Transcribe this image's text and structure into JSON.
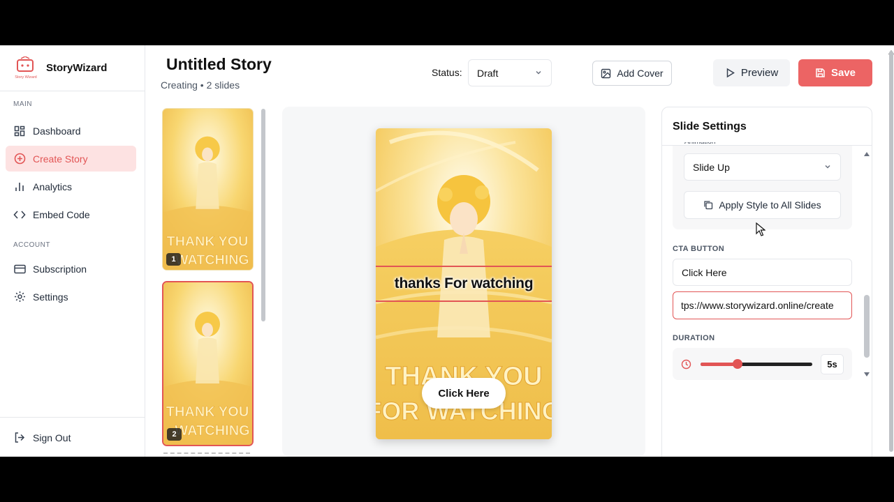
{
  "app": {
    "name": "StoryWizard",
    "logo_caption": "Story Wizard"
  },
  "sidebar": {
    "sections": [
      {
        "label": "MAIN",
        "items": [
          {
            "label": "Dashboard",
            "icon": "dashboard-icon"
          },
          {
            "label": "Create Story",
            "icon": "plus-circle-icon",
            "active": true
          },
          {
            "label": "Analytics",
            "icon": "bar-chart-icon"
          },
          {
            "label": "Embed Code",
            "icon": "code-icon"
          }
        ]
      },
      {
        "label": "ACCOUNT",
        "items": [
          {
            "label": "Subscription",
            "icon": "credit-card-icon"
          },
          {
            "label": "Settings",
            "icon": "gear-icon"
          }
        ]
      }
    ],
    "sign_out": "Sign Out"
  },
  "header": {
    "title": "Untitled Story",
    "subtitle": "Creating • 2 slides",
    "status_label": "Status:",
    "status_value": "Draft",
    "add_cover": "Add Cover",
    "preview": "Preview",
    "save": "Save"
  },
  "slides": [
    {
      "number": "1",
      "selected": false
    },
    {
      "number": "2",
      "selected": true
    }
  ],
  "thumb_art_text": [
    "THANK YOU",
    "WATCHING"
  ],
  "canvas": {
    "caption": "thanks For watching",
    "art_text_line1": "THANK YOU",
    "art_text_line2": "FOR WATCHING",
    "cta_label": "Click Here"
  },
  "settings": {
    "title": "Slide Settings",
    "animation_label": "Animation",
    "animation_value": "Slide Up",
    "apply_all": "Apply Style to All Slides",
    "cta_section": "CTA BUTTON",
    "cta_text": "Click Here",
    "cta_url": "tps://www.storywizard.online/create",
    "duration_section": "DURATION",
    "duration_value": "5s",
    "duration_fraction": 0.33
  },
  "colors": {
    "accent": "#e25555",
    "save_bg": "#ec6464",
    "active_nav_bg": "#fde2e2"
  }
}
